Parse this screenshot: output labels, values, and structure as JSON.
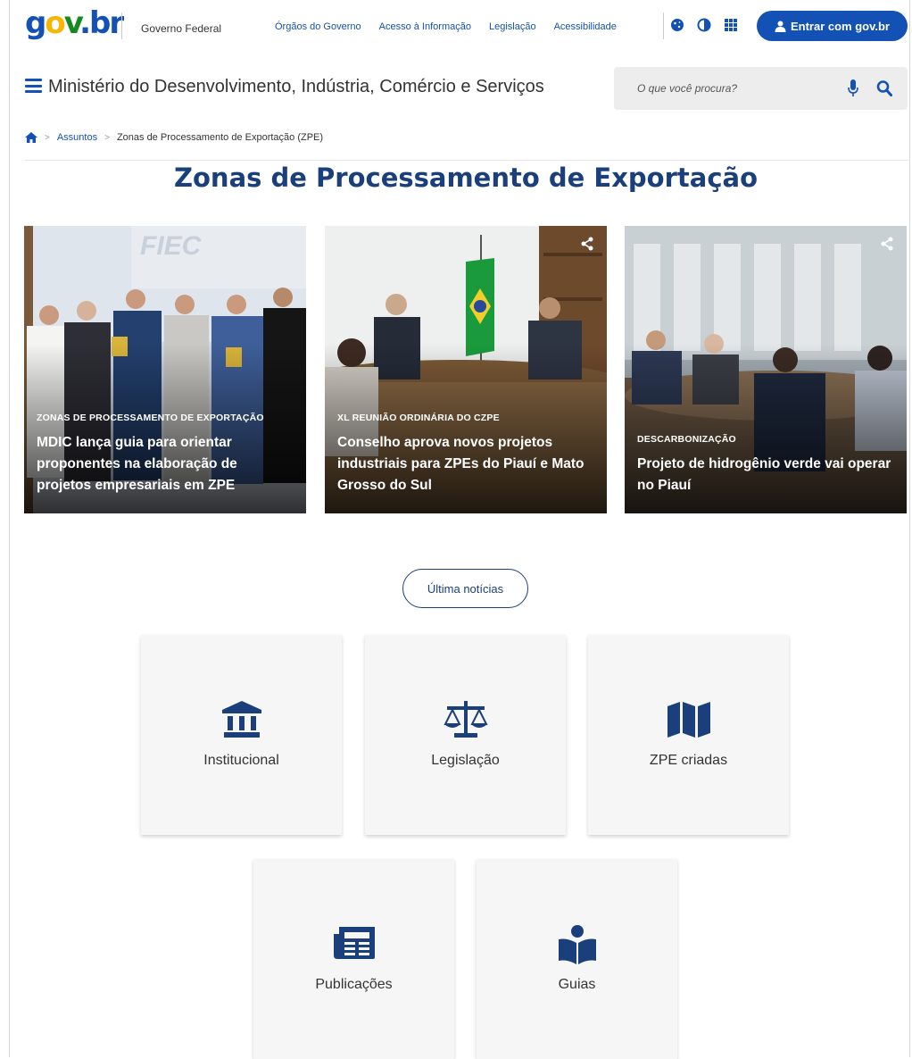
{
  "topbar": {
    "logo": {
      "g": "g",
      "o": "o",
      "v": "v",
      "b": ".br"
    },
    "gov_label": "Governo Federal",
    "links": [
      "Órgãos do Governo",
      "Acesso à Informação",
      "Legislação",
      "Acessibilidade"
    ],
    "icons": [
      "cookie-icon",
      "contrast-icon",
      "apps-grid-icon"
    ],
    "login_label": "Entrar com gov.br"
  },
  "header": {
    "site_title": "Ministério do Desenvolvimento, Indústria, Comércio e Serviços",
    "search_placeholder": "O que você procura?"
  },
  "breadcrumb": {
    "items": [
      "Assuntos",
      "Zonas de Processamento de Exportação (ZPE)"
    ]
  },
  "page": {
    "title": "Zonas de Processamento de Exportação"
  },
  "cards": [
    {
      "tag": "Zonas de Processamento de Exportação",
      "headline": "MDIC lança guia para orientar proponentes na elaboração de projetos empresariais em ZPE"
    },
    {
      "tag": "XL Reunião Ordinária do CZPE",
      "headline": "Conselho aprova novos projetos industriais para ZPEs do Piauí e Mato Grosso do Sul"
    },
    {
      "tag": "Descarbonização",
      "headline": "Projeto de hidrogênio verde vai operar no Piauí"
    }
  ],
  "news_button": "Última notícias",
  "tiles": [
    {
      "label": "Institucional",
      "icon": "institution-icon"
    },
    {
      "label": "Legislação",
      "icon": "scale-icon"
    },
    {
      "label": "ZPE criadas",
      "icon": "map-icon"
    },
    {
      "label": "Publicações",
      "icon": "newspaper-icon"
    },
    {
      "label": "Guias",
      "icon": "reader-icon"
    }
  ],
  "colors": {
    "primary": "#1351b4",
    "title": "#1a3f7a",
    "tile_bg": "#f6f6f6"
  }
}
